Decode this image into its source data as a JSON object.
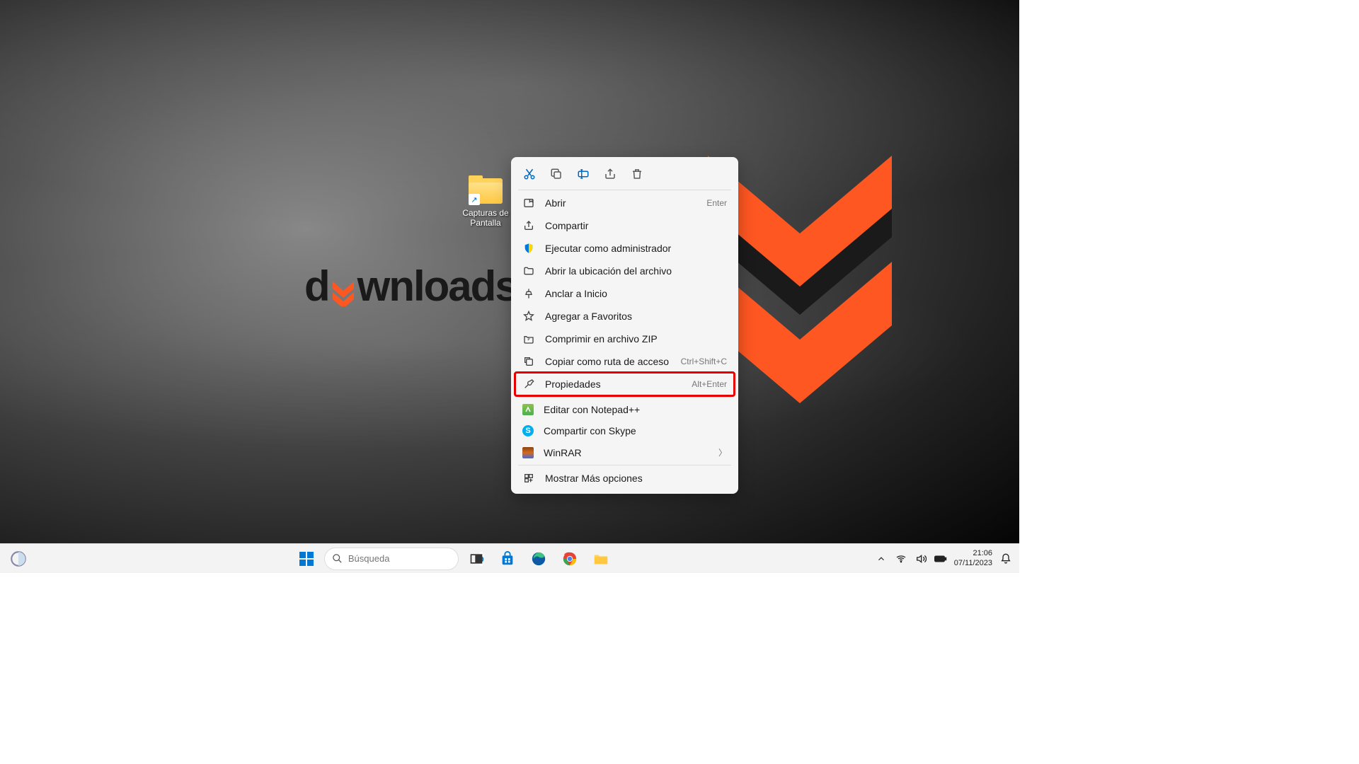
{
  "desktop": {
    "wallpaper_logo_text_pre": "d",
    "wallpaper_logo_text_post": "wnloads",
    "icon": {
      "label": "Capturas de Pantalla"
    }
  },
  "context_menu": {
    "topbar_icons": [
      "cut",
      "copy",
      "rename",
      "share",
      "delete"
    ],
    "items": [
      {
        "icon": "open",
        "label": "Abrir",
        "shortcut": "Enter"
      },
      {
        "icon": "share",
        "label": "Compartir"
      },
      {
        "icon": "shield",
        "label": "Ejecutar como administrador"
      },
      {
        "icon": "folder",
        "label": "Abrir la ubicación del archivo"
      },
      {
        "icon": "pin",
        "label": "Anclar a Inicio"
      },
      {
        "icon": "star",
        "label": "Agregar a Favoritos"
      },
      {
        "icon": "zip",
        "label": "Comprimir en archivo ZIP"
      },
      {
        "icon": "copy-path",
        "label": "Copiar como ruta de acceso",
        "shortcut": "Ctrl+Shift+C"
      },
      {
        "icon": "wrench",
        "label": "Propiedades",
        "shortcut": "Alt+Enter",
        "highlight": true
      }
    ],
    "app_items": [
      {
        "app": "npp",
        "label": "Editar con Notepad++"
      },
      {
        "app": "skype",
        "label": "Compartir con Skype"
      },
      {
        "app": "winrar",
        "label": "WinRAR",
        "submenu": true
      }
    ],
    "more_options": {
      "label": "Mostrar Más opciones"
    }
  },
  "taskbar": {
    "search_placeholder": "Búsqueda",
    "apps": [
      "task-view",
      "store",
      "edge",
      "chrome",
      "explorer"
    ],
    "tray": [
      "chevron-up",
      "wifi",
      "volume",
      "battery"
    ],
    "time": "21:06",
    "date": "07/11/2023"
  }
}
